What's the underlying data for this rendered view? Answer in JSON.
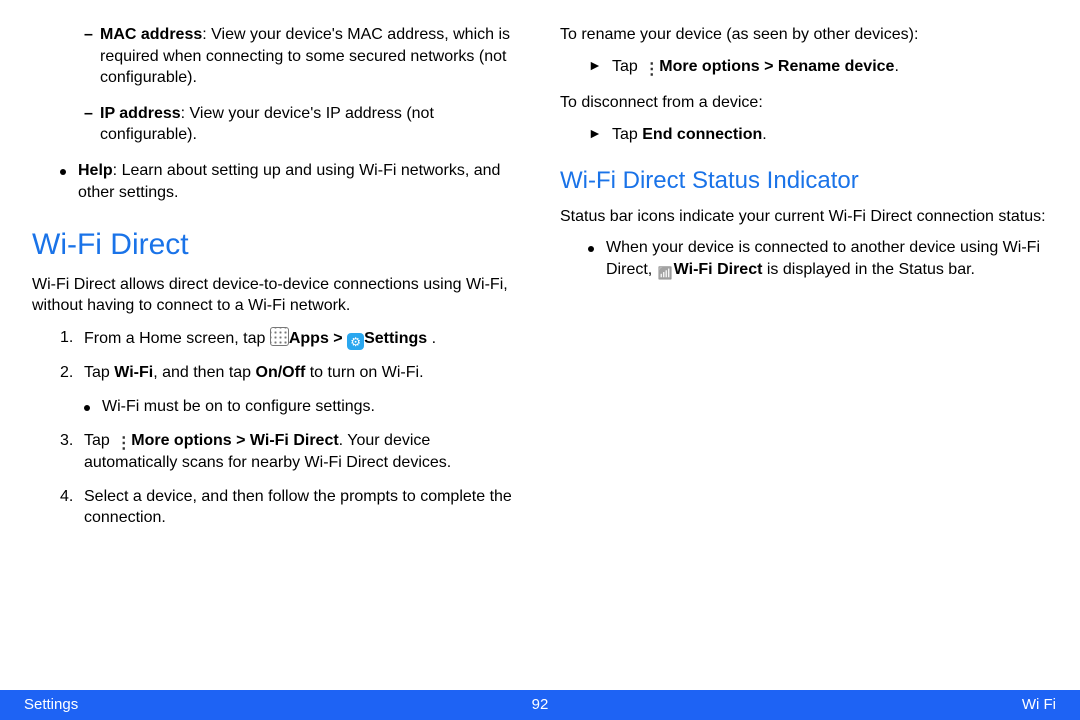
{
  "left": {
    "dash_mac_label": "MAC address",
    "dash_mac_text": ": View your device's MAC address, which is required when connecting to some secured networks (not configurable).",
    "dash_ip_label": "IP address",
    "dash_ip_text": ": View your device's IP address (not configurable).",
    "help_label": "Help",
    "help_text": ": Learn about setting up and using Wi-Fi networks, and other settings.",
    "h_wifi_direct": "Wi-Fi Direct",
    "wifi_direct_intro": "Wi-Fi Direct allows direct device-to-device connections using Wi-Fi, without having to connect to a Wi-Fi network.",
    "step1_a": "From a Home screen, tap ",
    "step1_apps": "Apps",
    "step1_gt": " > ",
    "step1_settings": "Settings",
    "step1_end": " .",
    "step2_a": "Tap ",
    "step2_wifi": "Wi-Fi",
    "step2_b": ", and then tap ",
    "step2_onoff": "On/Off",
    "step2_c": " to turn on Wi-Fi.",
    "step2_sub": "Wi-Fi must be on to configure settings.",
    "step3_a": "Tap ",
    "step3_more": "More options",
    "step3_gt": " > ",
    "step3_wd": "Wi-Fi Direct",
    "step3_b": ". Your device automatically scans for nearby Wi-Fi Direct devices.",
    "step4": "Select a device, and then follow the prompts to complete the connection."
  },
  "right": {
    "rename_intro": "To rename your device (as seen by other devices):",
    "rename_a": "Tap ",
    "rename_more": "More options",
    "rename_gt": " > ",
    "rename_dev": "Rename device",
    "rename_end": ".",
    "disc_intro": "To disconnect from a device:",
    "disc_a": "Tap ",
    "disc_end": "End connection",
    "disc_dot": ".",
    "h_status": "Wi-Fi Direct Status Indicator",
    "status_intro": "Status bar icons indicate your current Wi-Fi Direct connection status:",
    "status_a": "When your device is connected to another device using Wi-Fi Direct, ",
    "status_label": "Wi-Fi Direct",
    "status_b": " is displayed in the Status bar."
  },
  "footer": {
    "left": "Settings",
    "center": "92",
    "right": "Wi Fi"
  }
}
